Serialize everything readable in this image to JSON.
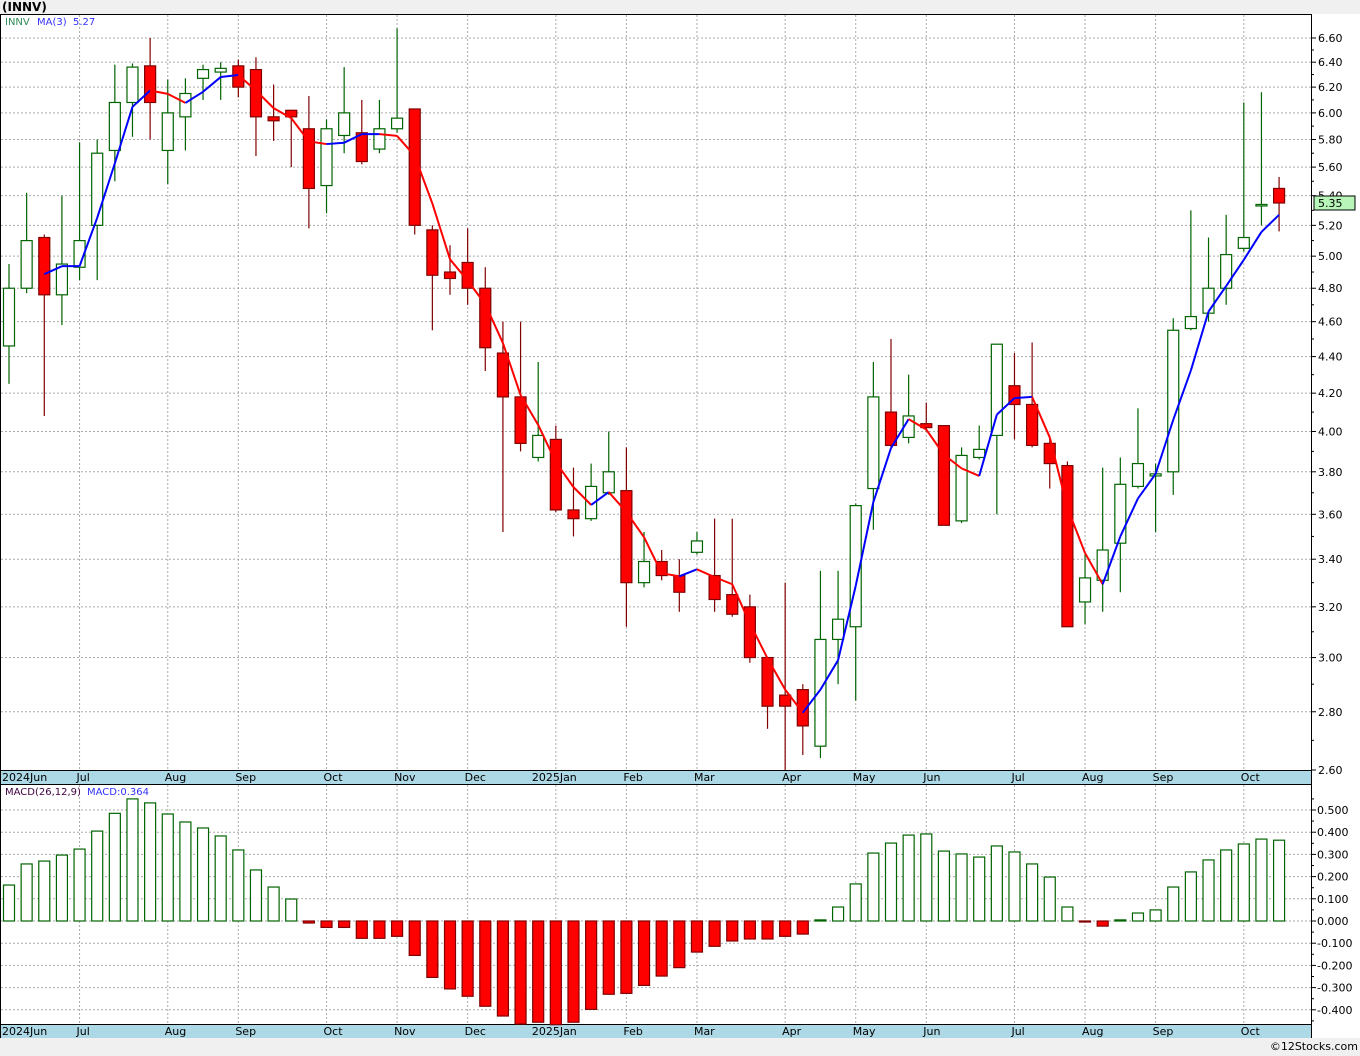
{
  "title": "(INNV)",
  "copyright": "©12Stocks.com",
  "colors": {
    "up": "#006400",
    "down_fill": "#ff0000",
    "down_stroke": "#800000",
    "ma_up": "#0000ff",
    "ma_down": "#ff0000",
    "axis_strip": "#add8e6",
    "last_price_bg": "#b8f5b8"
  },
  "chart_data": [
    {
      "type": "candlestick",
      "ticker": "INNV",
      "legend": {
        "symbol": "INNV",
        "ma_label": "MA(3)",
        "ma_value": "5.27"
      },
      "last_price": "5.35",
      "y_scale": "log",
      "ylim": [
        2.6,
        6.6
      ],
      "y_ticks": [
        "6.60",
        "6.40",
        "6.20",
        "6.00",
        "5.80",
        "5.60",
        "5.40",
        "5.20",
        "5.00",
        "4.80",
        "4.60",
        "4.40",
        "4.20",
        "4.00",
        "3.80",
        "3.60",
        "3.40",
        "3.20",
        "3.00",
        "2.80",
        "2.60"
      ],
      "grid": true,
      "x_ticks": [
        {
          "label": "2024Jun",
          "index": 0
        },
        {
          "label": "Jul",
          "index": 4
        },
        {
          "label": "Aug",
          "index": 9
        },
        {
          "label": "Sep",
          "index": 13
        },
        {
          "label": "Oct",
          "index": 18
        },
        {
          "label": "Nov",
          "index": 22
        },
        {
          "label": "Dec",
          "index": 26
        },
        {
          "label": "2025Jan",
          "index": 31
        },
        {
          "label": "Feb",
          "index": 35
        },
        {
          "label": "Mar",
          "index": 39
        },
        {
          "label": "Apr",
          "index": 44
        },
        {
          "label": "May",
          "index": 48
        },
        {
          "label": "Jun",
          "index": 52
        },
        {
          "label": "Jul",
          "index": 57
        },
        {
          "label": "Aug",
          "index": 61
        },
        {
          "label": "Sep",
          "index": 65
        },
        {
          "label": "Oct",
          "index": 70
        }
      ],
      "ohlc_fields": [
        "open",
        "high",
        "low",
        "close"
      ],
      "candles": [
        [
          4.46,
          4.95,
          4.25,
          4.8
        ],
        [
          4.8,
          5.42,
          4.77,
          5.1
        ],
        [
          5.12,
          5.14,
          4.08,
          4.76
        ],
        [
          4.76,
          5.4,
          4.58,
          4.95
        ],
        [
          4.93,
          5.78,
          4.85,
          5.1
        ],
        [
          5.2,
          5.8,
          4.85,
          5.7
        ],
        [
          5.72,
          6.38,
          5.5,
          6.08
        ],
        [
          6.08,
          6.39,
          5.82,
          6.36
        ],
        [
          6.37,
          6.6,
          5.8,
          6.08
        ],
        [
          5.72,
          6.26,
          5.48,
          6.0
        ],
        [
          5.97,
          6.27,
          5.72,
          6.15
        ],
        [
          6.27,
          6.38,
          6.1,
          6.34
        ],
        [
          6.32,
          6.4,
          6.1,
          6.35
        ],
        [
          6.37,
          6.42,
          6.12,
          6.2
        ],
        [
          6.34,
          6.44,
          5.68,
          5.97
        ],
        [
          5.97,
          6.22,
          5.79,
          5.94
        ],
        [
          6.02,
          6.02,
          5.6,
          5.97
        ],
        [
          5.88,
          6.13,
          5.18,
          5.45
        ],
        [
          5.47,
          5.95,
          5.28,
          5.88
        ],
        [
          5.83,
          6.36,
          5.7,
          6.0
        ],
        [
          5.85,
          6.1,
          5.62,
          5.64
        ],
        [
          5.73,
          6.1,
          5.7,
          5.88
        ],
        [
          5.88,
          6.68,
          5.85,
          5.96
        ],
        [
          6.03,
          6.03,
          5.14,
          5.2
        ],
        [
          5.17,
          5.2,
          4.55,
          4.88
        ],
        [
          4.9,
          5.07,
          4.76,
          4.86
        ],
        [
          4.96,
          5.18,
          4.7,
          4.8
        ],
        [
          4.8,
          4.93,
          4.32,
          4.45
        ],
        [
          4.42,
          4.6,
          3.52,
          4.18
        ],
        [
          4.18,
          4.6,
          3.9,
          3.94
        ],
        [
          3.87,
          4.37,
          3.85,
          3.98
        ],
        [
          3.96,
          4.03,
          3.61,
          3.62
        ],
        [
          3.62,
          3.82,
          3.5,
          3.58
        ],
        [
          3.58,
          3.84,
          3.57,
          3.73
        ],
        [
          3.7,
          4.0,
          3.69,
          3.8
        ],
        [
          3.71,
          3.92,
          3.12,
          3.3
        ],
        [
          3.3,
          3.52,
          3.28,
          3.39
        ],
        [
          3.39,
          3.44,
          3.31,
          3.33
        ],
        [
          3.33,
          3.4,
          3.18,
          3.26
        ],
        [
          3.43,
          3.52,
          3.42,
          3.48
        ],
        [
          3.33,
          3.58,
          3.18,
          3.23
        ],
        [
          3.25,
          3.58,
          3.16,
          3.17
        ],
        [
          3.2,
          3.25,
          2.98,
          3.0
        ],
        [
          3.0,
          3.0,
          2.74,
          2.82
        ],
        [
          2.86,
          3.3,
          2.6,
          2.82
        ],
        [
          2.88,
          2.9,
          2.65,
          2.75
        ],
        [
          2.68,
          3.35,
          2.64,
          3.07
        ],
        [
          3.07,
          3.35,
          2.9,
          3.15
        ],
        [
          3.12,
          3.65,
          2.84,
          3.64
        ],
        [
          3.72,
          4.37,
          3.53,
          4.18
        ],
        [
          4.1,
          4.5,
          3.92,
          3.93
        ],
        [
          3.97,
          4.3,
          3.94,
          4.08
        ],
        [
          4.04,
          4.15,
          4.0,
          4.02
        ],
        [
          4.03,
          4.03,
          3.55,
          3.55
        ],
        [
          3.57,
          3.92,
          3.56,
          3.88
        ],
        [
          3.87,
          4.03,
          3.86,
          3.91
        ],
        [
          3.98,
          4.47,
          3.6,
          4.47
        ],
        [
          4.24,
          4.42,
          3.96,
          4.14
        ],
        [
          4.14,
          4.48,
          3.92,
          3.93
        ],
        [
          3.94,
          3.97,
          3.72,
          3.84
        ],
        [
          3.83,
          3.85,
          3.12,
          3.12
        ],
        [
          3.22,
          3.42,
          3.13,
          3.32
        ],
        [
          3.31,
          3.82,
          3.18,
          3.44
        ],
        [
          3.47,
          3.87,
          3.26,
          3.74
        ],
        [
          3.73,
          4.12,
          3.72,
          3.84
        ],
        [
          3.78,
          3.84,
          3.52,
          3.79
        ],
        [
          3.8,
          4.62,
          3.69,
          4.55
        ],
        [
          4.56,
          5.3,
          4.55,
          4.63
        ],
        [
          4.65,
          5.12,
          4.6,
          4.8
        ],
        [
          4.8,
          5.27,
          4.7,
          5.01
        ],
        [
          5.05,
          6.08,
          5.03,
          5.12
        ],
        [
          5.33,
          6.16,
          5.2,
          5.34
        ],
        [
          5.45,
          5.53,
          5.16,
          5.35
        ]
      ],
      "ma_period": 3
    },
    {
      "type": "bar",
      "legend": {
        "label": "MACD(26,12,9)",
        "value_label": "MACD:0.364"
      },
      "ylim": [
        -0.47,
        0.6
      ],
      "y_ticks": [
        "0.500",
        "0.400",
        "0.300",
        "0.200",
        "0.100",
        "0.000",
        "-0.100",
        "-0.200",
        "-0.300",
        "-0.400"
      ],
      "grid": true,
      "values": [
        0.162,
        0.257,
        0.27,
        0.297,
        0.324,
        0.405,
        0.485,
        0.55,
        0.532,
        0.482,
        0.446,
        0.419,
        0.383,
        0.32,
        0.23,
        0.153,
        0.099,
        -0.009,
        -0.029,
        -0.029,
        -0.078,
        -0.078,
        -0.069,
        -0.155,
        -0.254,
        -0.306,
        -0.339,
        -0.384,
        -0.428,
        -0.464,
        -0.456,
        -0.467,
        -0.456,
        -0.398,
        -0.33,
        -0.326,
        -0.29,
        -0.248,
        -0.21,
        -0.14,
        -0.114,
        -0.09,
        -0.081,
        -0.081,
        -0.069,
        -0.059,
        0.005,
        0.063,
        0.167,
        0.306,
        0.351,
        0.387,
        0.392,
        0.315,
        0.302,
        0.288,
        0.338,
        0.311,
        0.257,
        0.198,
        0.063,
        -0.002,
        -0.023,
        0.005,
        0.036,
        0.05,
        0.153,
        0.221,
        0.275,
        0.32,
        0.347,
        0.369,
        0.364
      ]
    }
  ]
}
